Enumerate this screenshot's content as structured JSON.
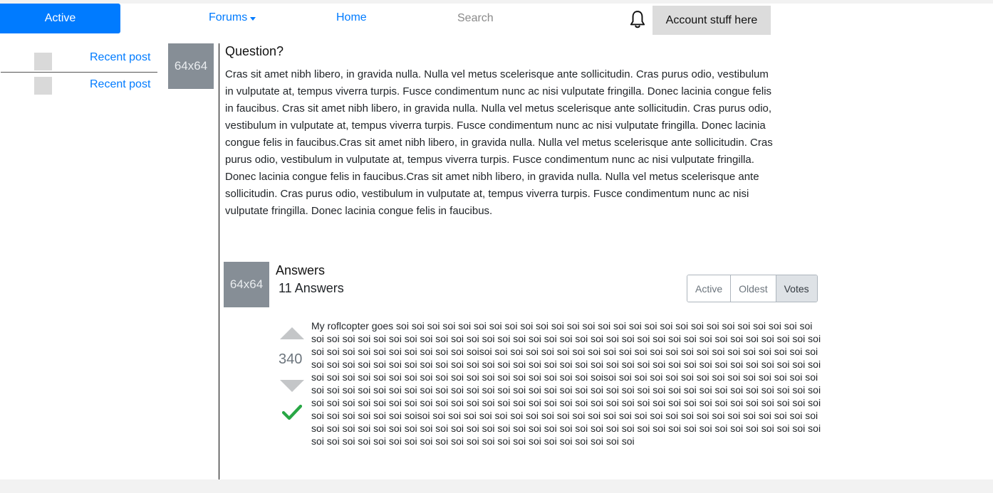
{
  "nav": {
    "active_label": "Active",
    "forums_label": "Forums",
    "home_label": "Home",
    "search_placeholder": "Search",
    "account_label": "Account stuff here",
    "icons": {
      "bell": "bell-icon",
      "forums_caret": "caret-down-icon"
    }
  },
  "sidebar": {
    "items": [
      {
        "label": "Recent post"
      },
      {
        "label": "Recent post"
      }
    ]
  },
  "question": {
    "avatar_label": "64x64",
    "title": "Question?",
    "body": "Cras sit amet nibh libero, in gravida nulla. Nulla vel metus scelerisque ante sollicitudin. Cras purus odio, vestibulum in vulputate at, tempus viverra turpis. Fusce condimentum nunc ac nisi vulputate fringilla. Donec lacinia congue felis in faucibus. Cras sit amet nibh libero, in gravida nulla. Nulla vel metus scelerisque ante sollicitudin.  Cras purus odio, vestibulum in vulputate at, tempus viverra turpis. Fusce condimentum nunc ac nisi vulputate fringilla. Donec lacinia congue felis in faucibus.Cras sit amet nibh libero, in gravida nulla. Nulla vel metus scelerisque ante sollicitudin. Cras purus odio, vestibulum in vulputate at, tempus viverra turpis. Fusce condimentum nunc ac nisi vulputate fringilla. Donec lacinia congue felis in faucibus.Cras sit amet nibh libero, in gravida nulla. Nulla vel metus scelerisque ante sollicitudin. Cras purus odio, vestibulum in vulputate at, tempus viverra turpis. Fusce condimentum nunc ac nisi vulputate fringilla. Donec lacinia congue felis in faucibus."
  },
  "answers": {
    "avatar_label": "64x64",
    "title": "Answers",
    "count_label": "11 Answers",
    "sort": {
      "options": [
        "Active",
        "Oldest",
        "Votes"
      ],
      "selected": "Votes"
    },
    "items": [
      {
        "votes": "340",
        "accepted": true,
        "body": "My roflcopter goes soi soi soi soi soi soi soi soi soi soi soi soi soi soi soi soi soi soi soi soi soi soi soi soi soi soi soi soi soi soi soi soi soi soi soi soi soi soi soi soi soi soi soi soi soi soi soi soi soi soi soi soi soi soi soi soi soi soi soi soi soi soi soi soi soi soi soi soi soi soi soisoi soi soi soi soi soi soi soi soi soi soi soi soi soi soi soi soi soi soi soi soi soi soi soi soi soi soi soi soi soi soi soi soi soi soi soi soi soi soi soi soi soi soi soi soi soi soi soi soi soi soi soi soi soi soi soi soi soi soi soi soi soi soi soi soi soi soi soi soi soi soi soi soi soisoi soi soi soi soi soi soi soi soi soi soi soi soi soi soi soi soi soi soi soi soi soi soi soi soi soi soi soi soi soi soi soi soi soi soi soi soi soi soi soi soi soi soi soi soi soi soi soi soi soi soi soi soi soi soi soi soi soi soi soi soi soi soi soi soi soi soi soi soi soi soi soi soi soi soi soi soi soi soi soi soi soi soi soi soi soi soisoi soi soi soi soi soi soi soi soi soi soi soi soi soi soi soi soi soi soi soi soi soi soi soi soi soi soi soi soi soi soi soi soi soi soi soi soi soi soi soi soi soi soi soi soi soi soi soi soi soi soi soi soi soi soi soi soi soi soi soi soi soi soi soi soi soi soi soi soi soi soi soi soi soi soi soi soi soi soi soi"
      }
    ]
  },
  "colors": {
    "accent": "#007bff",
    "placeholder_bg": "#868e96",
    "accepted_check": "#28a745",
    "vote_arrow": "#c4c6c8"
  }
}
